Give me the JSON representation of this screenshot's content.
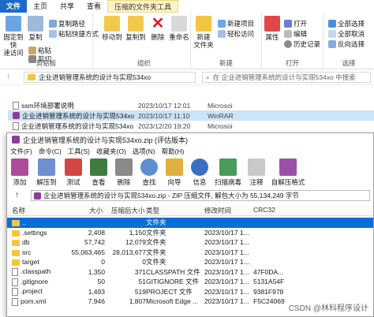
{
  "ribbon": {
    "tabs": [
      "文件",
      "主页",
      "共享",
      "查看",
      "压缩的文件夹工具"
    ],
    "clipboard": {
      "pin": "固定到快\n速访问",
      "copy": "复制",
      "paste": "粘贴",
      "cut": "剪切",
      "copy_path": "复制路径",
      "paste_shortcut": "粘贴快捷方式",
      "label": "剪贴板"
    },
    "organize": {
      "move_to": "移动到",
      "copy_to": "复制到",
      "delete": "删除",
      "rename": "重命名",
      "label": "组织"
    },
    "new": {
      "new_folder": "新建\n文件夹",
      "new_item": "新建项目",
      "easy_access": "轻松访问",
      "label": "新建"
    },
    "open": {
      "properties": "属性",
      "open": "打开",
      "edit": "编辑",
      "history": "历史记录",
      "label": "打开"
    },
    "select": {
      "all": "全部选择",
      "none": "全部取消",
      "invert": "反向选择",
      "label": "选择"
    }
  },
  "address": {
    "path": "企业进销管理系统的设计与实现534xo",
    "search_placeholder": "在 企业进销管理系统的设计与实现534xo 中搜索"
  },
  "explorer_files": [
    {
      "name": "ssm环境部署说明",
      "date": "2023/10/17 12:01",
      "type": "Microsoi"
    },
    {
      "name": "企业进销管理系统的设计与实现534xo",
      "date": "2023/10/17 11:10",
      "type": "WinRAR"
    },
    {
      "name": "企业进销管理系统的设计与实现534xo",
      "date": "2023/12/20 19:20",
      "type": "Microsoi"
    }
  ],
  "rar": {
    "title": "企业进销管理系统的设计与实现534xo.zip (评估版本)",
    "menu": [
      "文件(F)",
      "命令(C)",
      "工具(S)",
      "收藏夹(O)",
      "选项(N)",
      "帮助(H)"
    ],
    "toolbar": [
      "添加",
      "解压到",
      "测试",
      "查看",
      "删除",
      "查找",
      "向导",
      "信息",
      "扫描病毒",
      "注释",
      "自解压格式"
    ],
    "path": "企业进销管理系统的设计与实现534xo.zip - ZIP 压缩文件, 解包大小为 55,134,249 字节",
    "headers": [
      "名称",
      "大小",
      "压缩后大小",
      "类型",
      "修改时间",
      "CRC32"
    ],
    "rows": [
      {
        "name": "..",
        "size": "",
        "packed": "",
        "type": "文件夹",
        "mtime": "",
        "crc": ""
      },
      {
        "name": ".settings",
        "size": "2,408",
        "packed": "1,150",
        "type": "文件夹",
        "mtime": "2023/10/17 1...",
        "crc": ""
      },
      {
        "name": "db",
        "size": "57,742",
        "packed": "12,079",
        "type": "文件夹",
        "mtime": "2023/10/17 1...",
        "crc": ""
      },
      {
        "name": "src",
        "size": "55,063,465",
        "packed": "28,013,677",
        "type": "文件夹",
        "mtime": "2023/10/17 1...",
        "crc": ""
      },
      {
        "name": "target",
        "size": "0",
        "packed": "0",
        "type": "文件夹",
        "mtime": "2023/10/17 1...",
        "crc": ""
      },
      {
        "name": ".classpath",
        "size": "1,350",
        "packed": "371",
        "type": "CLASSPATH 文件",
        "mtime": "2023/10/17 1...",
        "crc": "47F0DA..."
      },
      {
        "name": ".gitignore",
        "size": "50",
        "packed": "51",
        "type": "GITIGNORE 文件",
        "mtime": "2023/10/17 1...",
        "crc": "5131A54F"
      },
      {
        "name": ".project",
        "size": "1,493",
        "packed": "519",
        "type": "PROJECT 文件",
        "mtime": "2023/10/17 1...",
        "crc": "9381F978"
      },
      {
        "name": "pom.xml",
        "size": "7,946",
        "packed": "1,807",
        "type": "Microsoft Edge ...",
        "mtime": "2023/10/17 1...",
        "crc": "F5C24069"
      }
    ]
  },
  "watermark": "CSDN @林科程序设计",
  "colors": {
    "accent": "#1b6ac9",
    "selection": "#0a6ed8"
  }
}
